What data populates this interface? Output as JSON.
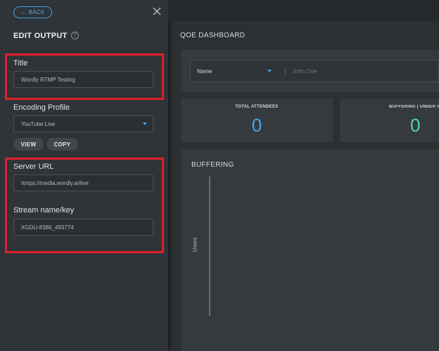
{
  "panel": {
    "back_label": "BACK",
    "title": "EDIT OUTPUT",
    "help_glyph": "?",
    "fields": {
      "title_label": "Title",
      "title_value": "Wordly RTMP Testing",
      "encoding_label": "Encoding Profile",
      "encoding_value": "YouTube Live",
      "view_label": "VIEW",
      "copy_label": "COPY",
      "server_label": "Server URL",
      "server_value": "rtmps://media.wordly.ai/live",
      "stream_label": "Stream name/key",
      "stream_value": "XGDU-8386_493774"
    }
  },
  "dashboard": {
    "title": "QOE DASHBOARD",
    "filter": {
      "name_label": "Name",
      "value": "John Doe"
    },
    "stats": [
      {
        "label": "TOTAL ATTENDEES",
        "value": "0",
        "color": "#4aa3e6"
      },
      {
        "label": "BUFFERING | UNDER S",
        "value": "0",
        "color": "#53d3a4"
      }
    ],
    "chart": {
      "title": "BUFFERING",
      "ylabel": "Users"
    }
  },
  "colors": {
    "accent": "#4a9fe0",
    "highlight": "#e0202a",
    "teal": "#53d3a4"
  }
}
